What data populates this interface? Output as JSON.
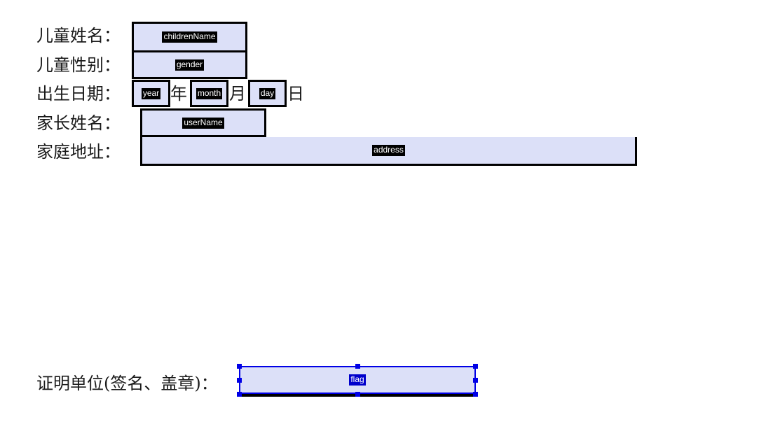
{
  "document": {
    "type": "form-template-designer-canvas",
    "background_color": "#ffffff",
    "field_fill_color": "#dce0f8",
    "field_border_color": "#000000",
    "token_bg_color": "#000000",
    "token_text_color": "#ffffff",
    "selection_color": "#0000e6",
    "selected_token_bg_color": "#0000cc"
  },
  "labels": {
    "children_name": "儿童姓名：",
    "children_gender": "儿童性别：",
    "birth_date": "出生日期：",
    "parent_name": "家长姓名：",
    "home_address": "家庭地址：",
    "certify_unit": "证明单位(签名、盖章)："
  },
  "separators": {
    "year": "年",
    "month": "月",
    "day": "日"
  },
  "fields": [
    {
      "name": "childrenName",
      "token": "childrenName"
    },
    {
      "name": "gender",
      "token": "gender"
    },
    {
      "name": "year",
      "token": "year"
    },
    {
      "name": "month",
      "token": "month"
    },
    {
      "name": "day",
      "token": "day"
    },
    {
      "name": "userName",
      "token": "userName"
    },
    {
      "name": "address",
      "token": "address"
    },
    {
      "name": "flag",
      "token": "flag",
      "selected": true
    }
  ]
}
